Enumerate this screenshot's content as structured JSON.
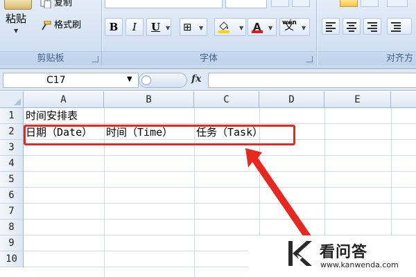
{
  "ribbon": {
    "clipboard": {
      "paste_label": "粘贴",
      "copy_label": "复制",
      "format_painter_label": "格式刷",
      "group_title": "剪贴板"
    },
    "font": {
      "bold": "B",
      "italic": "I",
      "underline": "U",
      "border_glyph": "⊞",
      "font_color_glyph": "A",
      "fill_color": "#ffd400",
      "font_color": "#e01b1b",
      "phonetic_top": "wén",
      "phonetic_char": "文",
      "group_title": "字体"
    },
    "alignment": {
      "group_title": "对齐方"
    }
  },
  "formula_bar": {
    "name_box": "C17",
    "fx_label": "fx",
    "formula_value": ""
  },
  "sheet": {
    "columns": [
      "A",
      "B",
      "C",
      "D",
      "E"
    ],
    "rows": [
      "1",
      "2",
      "3",
      "4",
      "5",
      "6",
      "7",
      "8",
      "9",
      "10"
    ],
    "cells": {
      "A1": "时间安排表",
      "A2": "日期（Date）",
      "B2": "时间（Time）",
      "C2": "任务（Task）"
    }
  },
  "annotation": {
    "highlight_color": "#e8281e"
  },
  "watermark": {
    "title": "看问答",
    "url": "www.kanwenda.com"
  }
}
